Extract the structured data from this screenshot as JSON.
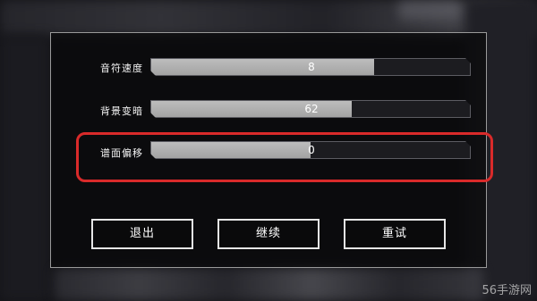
{
  "settings": [
    {
      "label": "音符速度",
      "value": "8",
      "fill": 0.7
    },
    {
      "label": "背景变暗",
      "value": "62",
      "fill": 0.63
    },
    {
      "label": "谱面偏移",
      "value": "0",
      "fill": 0.5
    }
  ],
  "buttons": {
    "exit_label": "退出",
    "continue_label": "继续",
    "retry_label": "重试"
  },
  "watermark": "56手游网",
  "colors": {
    "highlight": "#d92a2a",
    "fill": "#b0b0b0"
  }
}
